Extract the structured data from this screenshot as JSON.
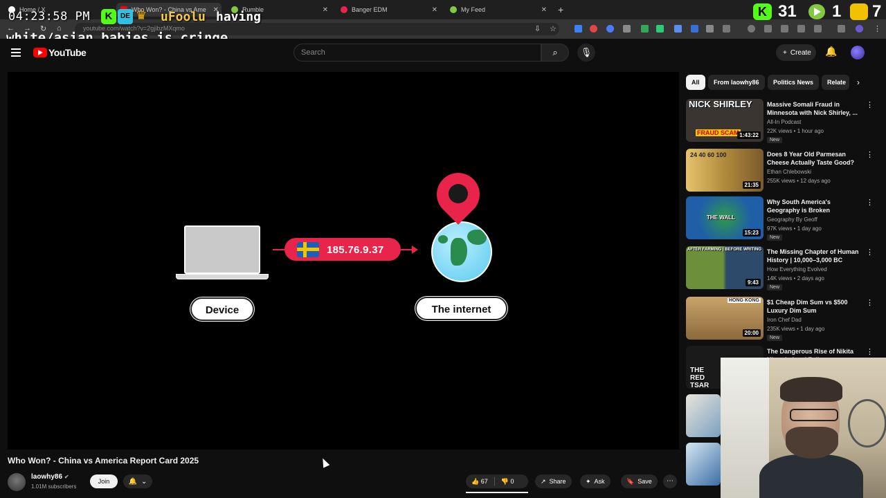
{
  "browser": {
    "tabs": [
      {
        "label": "Home / X"
      },
      {
        "label": "Who Won? - China vs Ame"
      },
      {
        "label": "Rumble"
      },
      {
        "label": "Banger EDM"
      },
      {
        "label": "My Feed"
      }
    ],
    "url": "youtube.com/watch?v=2gjibzMXqmo"
  },
  "overlay": {
    "clock": "04:23:58 PM",
    "chat_user": "uFoolu",
    "chat_text_1": "having",
    "chat_text_2": "white/asian babies is cringe",
    "badge_dev": "DE",
    "counts": {
      "kick": "31",
      "rumble": "1",
      "other": "7"
    }
  },
  "header": {
    "brand": "YouTube",
    "search_placeholder": "Search",
    "create_label": "Create"
  },
  "video": {
    "graphic": {
      "ip_address": "185.76.9.37",
      "device_label": "Device",
      "internet_label": "The internet"
    },
    "title": "Who Won? - China vs America Report Card 2025",
    "channel": "laowhy86",
    "subscribers": "1.01M subscribers",
    "join_label": "Join",
    "likes": "67",
    "dislikes": "0",
    "share_label": "Share",
    "ask_label": "Ask",
    "save_label": "Save"
  },
  "chips": [
    "All",
    "From laowhy86",
    "Politics News",
    "Relate"
  ],
  "recommendations": [
    {
      "title": "Massive Somali Fraud in Minnesota with Nick Shirley, ...",
      "channel": "All-In Podcast",
      "meta": "22K views • 1 hour ago",
      "badge": "New",
      "duration": "1:43:22",
      "thumb_text": "NICK SHIRLEY",
      "thumb_caption": "FRAUD SCAM",
      "thumb_color": "#3a3530"
    },
    {
      "title": "Does 8 Year Old Parmesan Cheese Actually Taste Good?",
      "channel": "Ethan Chlebowski",
      "meta": "255K views • 12 days ago",
      "badge": "",
      "duration": "21:35",
      "thumb_text": "24 40 60 100",
      "thumb_caption": "",
      "thumb_color": "#b08a3c"
    },
    {
      "title": "Why South America's Geography is Broken",
      "channel": "Geography By Geoff",
      "meta": "97K views • 1 day ago",
      "badge": "New",
      "duration": "15:23",
      "thumb_text": "THE WALL",
      "thumb_caption": "",
      "thumb_color": "#1f5fa8"
    },
    {
      "title": "The Missing Chapter of Human History | 10,000–3,000 BC",
      "channel": "How Everything Evolved",
      "meta": "14K views • 2 days ago",
      "badge": "New",
      "duration": "9:43",
      "thumb_text": "AFTER FARMING | BEFORE WRITING",
      "thumb_caption": "",
      "thumb_color": "#2d4a6b"
    },
    {
      "title": "$1 Cheap Dim Sum vs $500 Luxury Dim Sum",
      "channel": "Iron Chef Dad",
      "meta": "235K views • 1 day ago",
      "badge": "New",
      "duration": "20:00",
      "thumb_text": "HONG KONG",
      "thumb_caption": "",
      "thumb_color": "#8c6a3a"
    },
    {
      "title": "The Dangerous Rise of Nikita Khrushchev | Full Documentary",
      "channel": "",
      "meta": "",
      "badge": "",
      "duration": "",
      "thumb_text": "THE RED TSAR",
      "thumb_caption": "",
      "thumb_color": "#1a1a1a"
    }
  ],
  "colors": {
    "accent_red": "#e8244a",
    "yt_red": "#ff0000",
    "kick_green": "#53fc18"
  }
}
